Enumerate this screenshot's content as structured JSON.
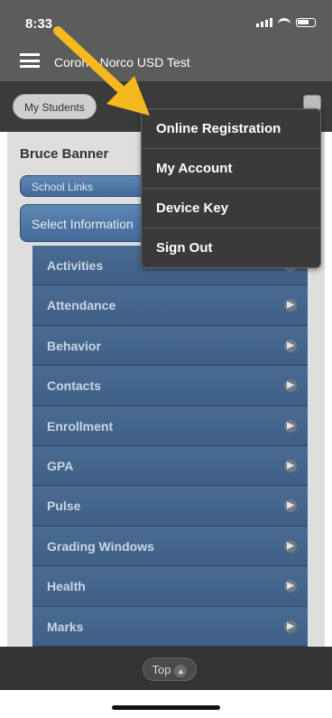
{
  "status": {
    "time": "8:33",
    "location_icon": "location-arrow-icon"
  },
  "header": {
    "title": "Corona-Norco USD Test"
  },
  "toolbar": {
    "my_students_label": "My Students"
  },
  "student": {
    "name": "Bruce Banner"
  },
  "buttons": {
    "school_links": "School Links",
    "select_information": "Select Information"
  },
  "list": [
    "Activities",
    "Attendance",
    "Behavior",
    "Contacts",
    "Enrollment",
    "GPA",
    "Pulse",
    "Grading Windows",
    "Health",
    "Marks"
  ],
  "dropdown": [
    "Online Registration",
    "My Account",
    "Device Key",
    "Sign Out"
  ],
  "footer": {
    "top_label": "Top"
  },
  "colors": {
    "annotation_arrow": "#f5b81e"
  }
}
